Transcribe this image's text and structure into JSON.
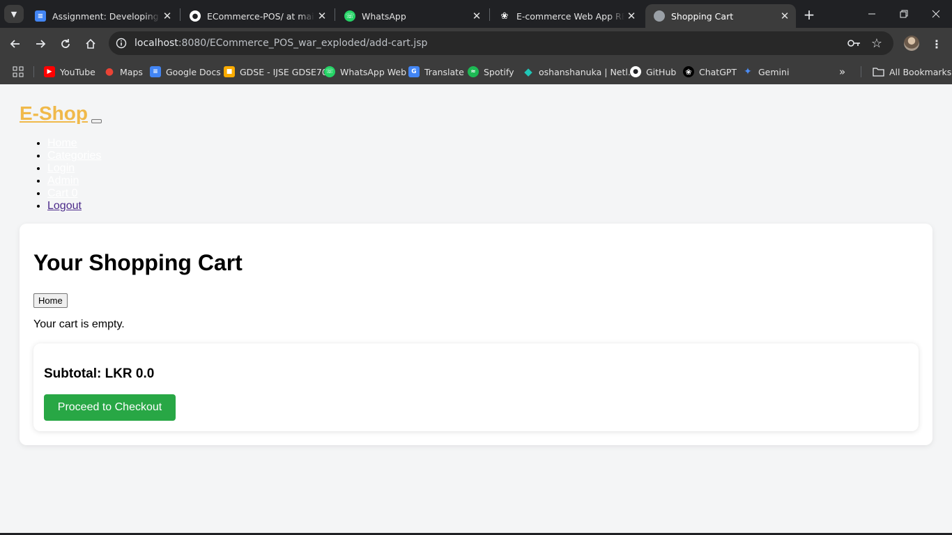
{
  "browser": {
    "tabs": [
      {
        "title": "Assignment: Developing a Fu",
        "icon": "google-docs-icon",
        "color": "#4285f4"
      },
      {
        "title": "ECommerce-POS/ at main · o",
        "icon": "github-icon",
        "color": "#ffffff"
      },
      {
        "title": "WhatsApp",
        "icon": "whatsapp-icon",
        "color": "#25d366"
      },
      {
        "title": "E-commerce Web App READ",
        "icon": "chatgpt-icon",
        "color": "#ffffff"
      },
      {
        "title": "Shopping Cart",
        "icon": "globe-icon",
        "color": "#bdc1c6",
        "active": true
      }
    ],
    "url_host": "localhost",
    "url_path": ":8080/ECommerce_POS_war_exploded/add-cart.jsp",
    "bookmarks": [
      {
        "label": "YouTube",
        "icon": "youtube-icon",
        "color": "#ff0000"
      },
      {
        "label": "Maps",
        "icon": "maps-icon",
        "color": "#34a853"
      },
      {
        "label": "Google Docs",
        "icon": "google-docs-icon",
        "color": "#4285f4"
      },
      {
        "label": "GDSE - IJSE GDSE70",
        "icon": "classroom-icon",
        "color": "#f9ab00"
      },
      {
        "label": "WhatsApp Web",
        "icon": "whatsapp-icon",
        "color": "#25d366"
      },
      {
        "label": "Translate",
        "icon": "translate-icon",
        "color": "#4285f4"
      },
      {
        "label": "Spotify",
        "icon": "spotify-icon",
        "color": "#1db954"
      },
      {
        "label": "oshanshanuka | Netl...",
        "icon": "netlify-icon",
        "color": "#20c6b7"
      },
      {
        "label": "GitHub",
        "icon": "github-icon",
        "color": "#ffffff"
      },
      {
        "label": "ChatGPT",
        "icon": "chatgpt-icon",
        "color": "#ffffff"
      },
      {
        "label": "Gemini",
        "icon": "gemini-icon",
        "color": "#4c8df6"
      }
    ],
    "all_bookmarks": "All Bookmarks"
  },
  "page": {
    "brand": "E-Shop",
    "nav": [
      "Home",
      "Categories",
      "Login",
      "Admin",
      "Cart 0",
      "Logout"
    ],
    "cart_title": "Your Shopping Cart",
    "home_button": "Home",
    "empty_message": "Your cart is empty.",
    "subtotal": "Subtotal: LKR 0.0",
    "checkout_button": "Proceed to Checkout",
    "accent_color": "#f0b94a",
    "checkout_color": "#28a745"
  }
}
